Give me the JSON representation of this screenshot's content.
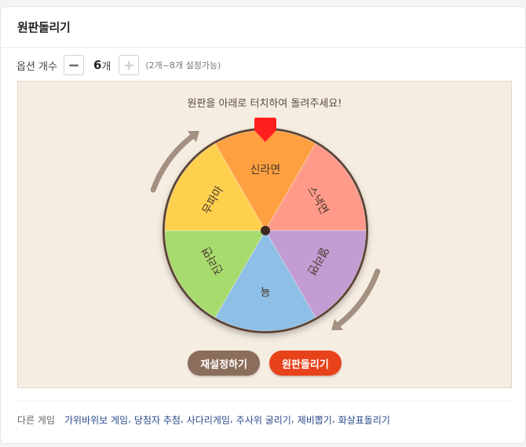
{
  "card": {
    "title": "원판돌리기"
  },
  "options": {
    "label": "옵션 개수",
    "minus_symbol": "−",
    "plus_symbol": "+",
    "count": "6",
    "unit": "개",
    "range_note": "(2개~8개 설정가능)"
  },
  "wheel": {
    "instruction": "원판을 아래로 터치하여 돌려주세요!",
    "slices": [
      {
        "label": "신라면",
        "color": "#ffa040"
      },
      {
        "label": "스낵면",
        "color": "#ff9a8a"
      },
      {
        "label": "열라면",
        "color": "#c29cd2"
      },
      {
        "label": "육",
        "color": "#8ebfe6"
      },
      {
        "label": "진라면",
        "color": "#a8db6e"
      },
      {
        "label": "무파마",
        "color": "#ffd04e"
      }
    ],
    "rim_color": "#5a4233",
    "pointer_color": "#ff1e1e",
    "arrow_color": "#a39080"
  },
  "buttons": {
    "reset": "재설정하기",
    "spin": "원판돌리기"
  },
  "footer": {
    "label": "다른 게임",
    "games": [
      "가위바위보 게임",
      "당첨자 추첨",
      "사다리게임",
      "주사위 굴리기",
      "제비뽑기",
      "화살표돌리기"
    ]
  }
}
